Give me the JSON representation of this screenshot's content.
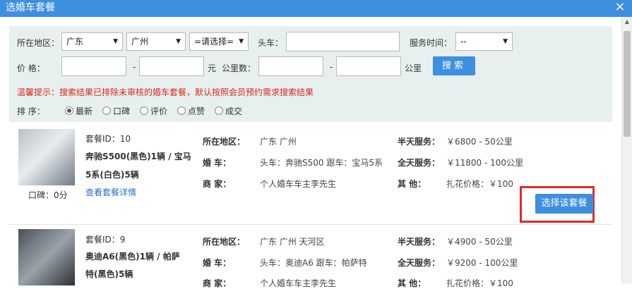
{
  "dialog": {
    "title": "选婚车套餐",
    "close": "×"
  },
  "filter": {
    "region_label": "所在地区：",
    "province": "广东",
    "city": "广州",
    "district": "=请选择=",
    "lead_car_label": "头车：",
    "service_time_label": "服务时间：",
    "service_time": "--",
    "price_label": "价      格：",
    "dash": "-",
    "yuan": "元",
    "km_label": "公里数：",
    "km_unit": "公里",
    "search": "搜索",
    "tip": "温馨提示：搜索结果已排除未审核的婚车套餐，默认按照会员预约需求搜索结果",
    "sort_label": "排      序：",
    "sort_options": [
      "最新",
      "口碑",
      "评价",
      "点赞",
      "成交"
    ]
  },
  "labels": {
    "region": "所在地区：",
    "car": "婚      车：",
    "merchant": "商      家：",
    "half_day": "半天服务：",
    "full_day": "全天服务：",
    "other": "其      他："
  },
  "packages": [
    {
      "id": "套餐ID：10",
      "title_line1": "奔驰S500(黑色)1辆 / 宝马",
      "title_line2": "5系(白色)5辆",
      "rating": "口碑：0分",
      "detail_link": "查看套餐详情",
      "region": "广东  广州",
      "cars": "头车：奔驰S500  跟车：宝马5系",
      "merchant": "个人婚车车主李先生",
      "half_day": "￥6800 - 50公里",
      "full_day": "￥11800 - 100公里",
      "other": "扎花价格：￥100",
      "choose": "选择该套餐"
    },
    {
      "id": "套餐ID：9",
      "title_line1": "奥迪A6(黑色)1辆 / 帕萨",
      "title_line2": "特(黑色)5辆",
      "region": "广东  广州  天河区",
      "cars": "头车：奥迪A6  跟车：帕萨特",
      "merchant": "个人婚车车主李先生",
      "half_day": "￥4900 - 50公里",
      "full_day": "￥9200 - 100公里",
      "other": "扎花价格：￥100"
    }
  ]
}
